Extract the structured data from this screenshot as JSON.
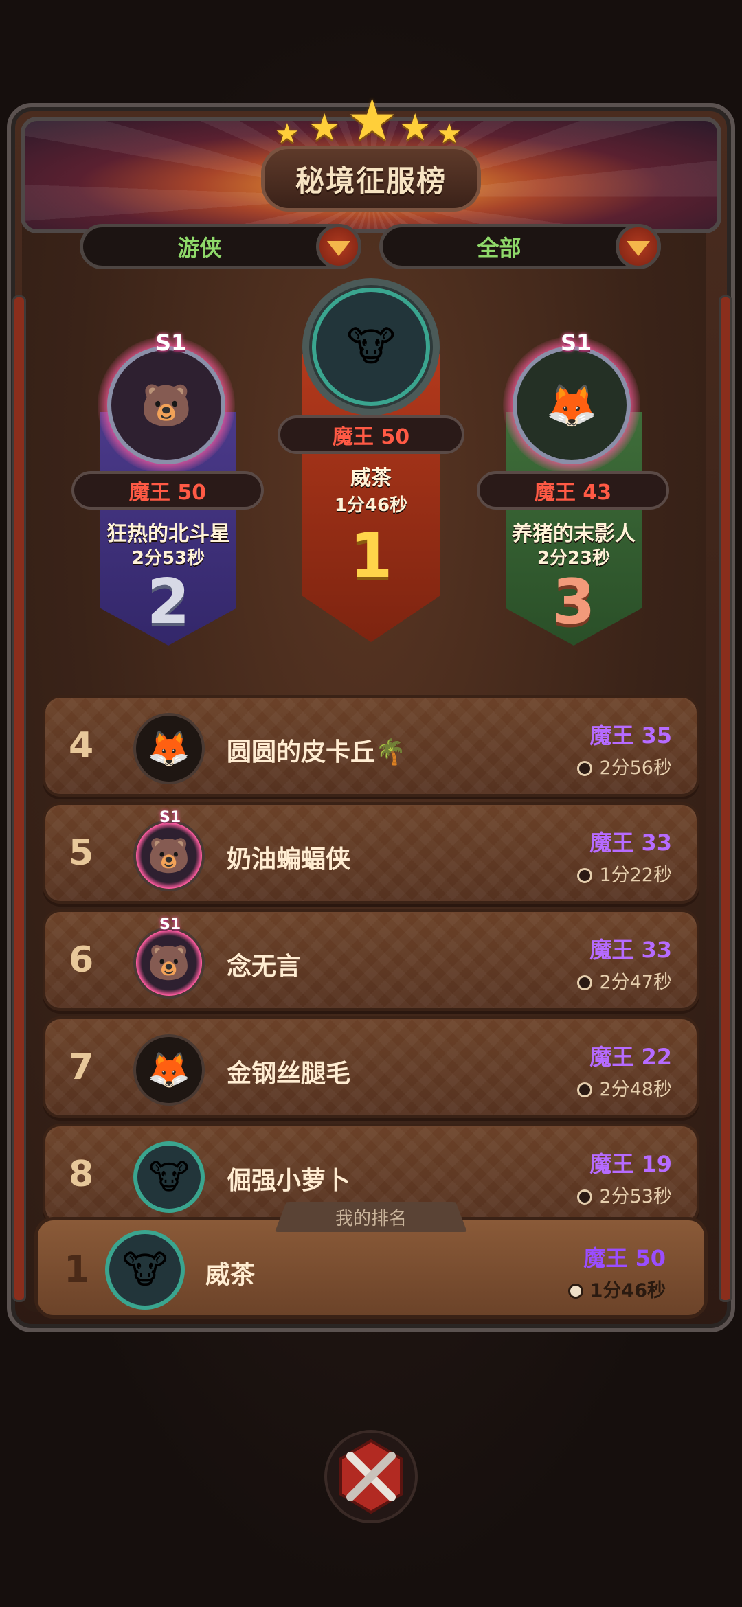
{
  "header": {
    "title": "秘境征服榜",
    "stars": 5
  },
  "filters": [
    {
      "label": "游侠"
    },
    {
      "label": "全部"
    }
  ],
  "podium": [
    {
      "rank": "1",
      "score": "魔王 50",
      "name": "威茶",
      "time": "1分46秒",
      "season": ""
    },
    {
      "rank": "2",
      "score": "魔王 50",
      "name": "狂热的北斗星",
      "time": "2分53秒",
      "season": "S1"
    },
    {
      "rank": "3",
      "score": "魔王 43",
      "name": "养猪的末影人",
      "time": "2分23秒",
      "season": "S1"
    }
  ],
  "rows": [
    {
      "rank": "4",
      "name": "圆圆的皮卡丘🌴",
      "score": "魔王 35",
      "time": "2分56秒",
      "season": ""
    },
    {
      "rank": "5",
      "name": "奶油蝙蝠侠",
      "score": "魔王 33",
      "time": "1分22秒",
      "season": "S1"
    },
    {
      "rank": "6",
      "name": "念无言",
      "score": "魔王 33",
      "time": "2分47秒",
      "season": "S1"
    },
    {
      "rank": "7",
      "name": "金钢丝腿毛",
      "score": "魔王 22",
      "time": "2分48秒",
      "season": ""
    },
    {
      "rank": "8",
      "name": "倔强小萝卜",
      "score": "魔王 19",
      "time": "2分53秒",
      "season": ""
    }
  ],
  "my_rank": {
    "label": "我的排名",
    "rank": "1",
    "name": "威茶",
    "score": "魔王 50",
    "time": "1分46秒"
  },
  "colors": {
    "score_red": "#ff5a45",
    "score_purple": "#b66bff",
    "filter_green": "#8fd96a"
  },
  "icons": [
    "star-icon",
    "dropdown-arrow-icon",
    "clock-icon",
    "close-crossed-swords-icon"
  ]
}
